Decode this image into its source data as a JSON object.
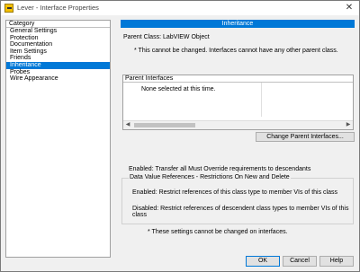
{
  "window": {
    "title": "Lever - Interface Properties",
    "close_glyph": "✕"
  },
  "category": {
    "header": "Category",
    "items": [
      {
        "label": "General Settings",
        "selected": false
      },
      {
        "label": "Protection",
        "selected": false
      },
      {
        "label": "Documentation",
        "selected": false
      },
      {
        "label": "Item Settings",
        "selected": false
      },
      {
        "label": "Friends",
        "selected": false
      },
      {
        "label": "Inheritance",
        "selected": true
      },
      {
        "label": "Probes",
        "selected": false
      },
      {
        "label": "Wire Appearance",
        "selected": false
      }
    ]
  },
  "inheritance": {
    "header": "Inheritance",
    "parent_class": "Parent Class: LabVIEW Object",
    "note1": "* This cannot be changed. Interfaces cannot have any other parent class.",
    "parent_interfaces": {
      "header": "Parent Interfaces",
      "empty_text": "None selected at this time."
    },
    "change_button": "Change Parent Interfaces...",
    "enabled_transfer": "Enabled: Transfer all Must Override requirements to descendants",
    "dv_group_title": "Data Value References - Restrictions On New and Delete",
    "dv_enabled": "Enabled: Restrict references of this class type to member VIs of this class",
    "dv_disabled": "Disabled: Restrict references of descendent class types to member VIs of this class",
    "note2": "* These settings cannot be changed on interfaces."
  },
  "buttons": {
    "ok": "OK",
    "cancel": "Cancel",
    "help": "Help"
  },
  "colors": {
    "accent": "#0078d7"
  }
}
